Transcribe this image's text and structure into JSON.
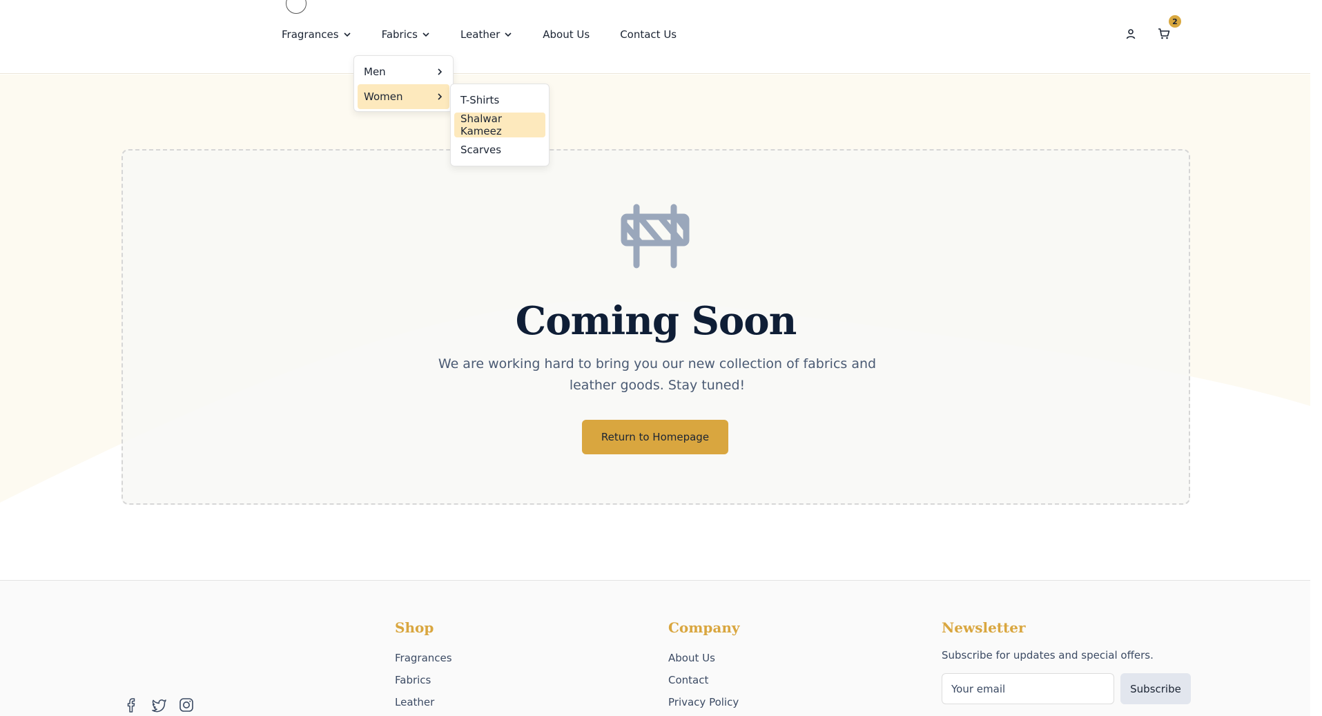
{
  "header": {
    "nav": [
      {
        "label": "Fragrances",
        "has_dropdown": true
      },
      {
        "label": "Fabrics",
        "has_dropdown": true
      },
      {
        "label": "Leather",
        "has_dropdown": true
      },
      {
        "label": "About Us",
        "has_dropdown": false
      },
      {
        "label": "Contact Us",
        "has_dropdown": false
      }
    ],
    "cart_count": "2",
    "icons": [
      "user-icon",
      "cart-icon"
    ]
  },
  "dropdown": {
    "level1": [
      {
        "label": "Men",
        "active": false
      },
      {
        "label": "Women",
        "active": true
      }
    ],
    "level2": [
      {
        "label": "T-Shirts",
        "active": false
      },
      {
        "label": "Shalwar Kameez",
        "active": true
      },
      {
        "label": "Scarves",
        "active": false
      }
    ]
  },
  "hero": {
    "icon": "construction-barrier-icon",
    "title": "Coming Soon",
    "subtitle": "We are working hard to bring you our new collection of fabrics and leather goods. Stay tuned!",
    "cta_label": "Return to Homepage"
  },
  "footer": {
    "shop": {
      "title": "Shop",
      "links": [
        "Fragrances",
        "Fabrics",
        "Leather"
      ]
    },
    "company": {
      "title": "Company",
      "links": [
        "About Us",
        "Contact",
        "Privacy Policy"
      ]
    },
    "newsletter": {
      "title": "Newsletter",
      "text": "Subscribe for updates and special offers.",
      "placeholder": "Your email",
      "button": "Subscribe"
    },
    "socials": [
      "facebook-icon",
      "twitter-icon",
      "instagram-icon"
    ]
  },
  "colors": {
    "accent": "#d9a63f",
    "highlight": "#fde9bd",
    "navy": "#0f1e36"
  }
}
